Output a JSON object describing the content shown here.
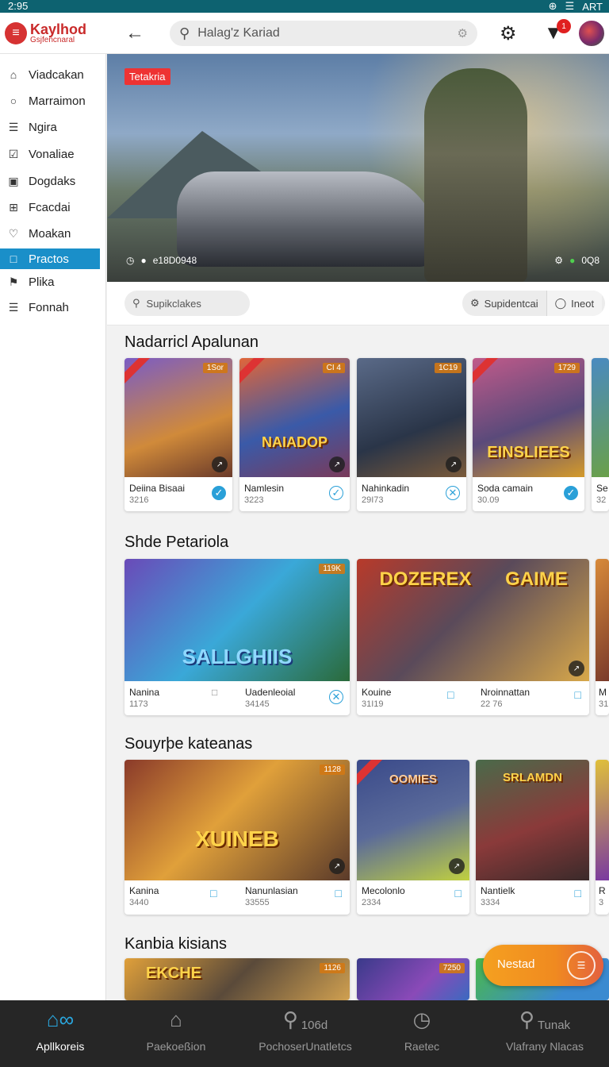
{
  "status_bar": {
    "time": "2:95",
    "right_text": "ART"
  },
  "header": {
    "logo_name": "Kaylhod",
    "logo_sub": "Gsjfencnaral",
    "search_placeholder": "Halag'z Kariad",
    "notification_count": "1"
  },
  "sidebar": {
    "items": [
      {
        "label": "Viadcakan",
        "icon": "house-icon"
      },
      {
        "label": "Marraimon",
        "icon": "user-icon"
      },
      {
        "label": "Ngira",
        "icon": "list-icon"
      },
      {
        "label": "Vonaliae",
        "icon": "checkbox-icon"
      },
      {
        "label": "Dogdaks",
        "icon": "square-icon"
      },
      {
        "label": "Fcacdai",
        "icon": "grid-icon"
      },
      {
        "label": "Moakan",
        "icon": "heart-icon"
      },
      {
        "label": "Practos",
        "icon": "box-icon",
        "active": true
      },
      {
        "label": "Plika",
        "icon": "flag-icon"
      },
      {
        "label": "Fonnah",
        "icon": "list-icon"
      }
    ]
  },
  "hero": {
    "tag": "Tetakria",
    "left_meta": "e18D0948",
    "right_meta": "0Q8"
  },
  "filters": {
    "search_placeholder": "Supikclakes",
    "segment_1": "Supidentcai",
    "segment_2": "Ineot"
  },
  "sections": [
    {
      "title": "Nadarricl Apalunan",
      "cards": [
        {
          "name": "Deiina Bisaai",
          "num": "3216",
          "badge": "1Sor",
          "art_title": ""
        },
        {
          "name": "Namlesin",
          "num": "3223",
          "badge": "CI 4",
          "art_title": "NAIADOP"
        },
        {
          "name": "Nahinkadin",
          "num": "29I73",
          "badge": "1C19",
          "art_title": ""
        },
        {
          "name": "Soda camain",
          "num": "30.09",
          "badge": "1729",
          "art_title": "EINSLIEES"
        },
        {
          "name": "Se",
          "num": "32",
          "badge": "",
          "art_title": ""
        }
      ]
    },
    {
      "title": "Shde Petariola",
      "cards": [
        {
          "name": "Nanina",
          "num": "1173",
          "badge": "",
          "art_title": ""
        },
        {
          "name": "Uadenleoial",
          "num": "34145",
          "badge": "119K",
          "art_title": "SALLGHIIS"
        },
        {
          "name": "Kouine",
          "num": "31I19",
          "badge": "",
          "art_title": "DOZEREX"
        },
        {
          "name": "Nroinnattan",
          "num": "22 76",
          "badge": "",
          "art_title": "GAIME"
        },
        {
          "name": "M",
          "num": "31",
          "badge": "",
          "art_title": ""
        }
      ]
    },
    {
      "title": "Souyrþe kateanas",
      "cards": [
        {
          "name": "Kanina",
          "num": "3440",
          "badge": "",
          "art_title": ""
        },
        {
          "name": "Nanunlasian",
          "num": "33555",
          "badge": "1128",
          "art_title": "XUINEB"
        },
        {
          "name": "Mecolonlo",
          "num": "2334",
          "badge": "",
          "art_title": "OOMIES"
        },
        {
          "name": "Nantielk",
          "num": "3334",
          "badge": "",
          "art_title": "SRLAMDN"
        },
        {
          "name": "R",
          "num": "3",
          "badge": "",
          "art_title": ""
        }
      ]
    },
    {
      "title": "Kanbia kisians",
      "cards": [
        {
          "name": "",
          "num": "",
          "badge": "1126",
          "art_title": "EKCHE"
        },
        {
          "name": "",
          "num": "",
          "badge": "7250",
          "art_title": ""
        },
        {
          "name": "",
          "num": "",
          "badge": "",
          "art_title": ""
        }
      ]
    }
  ],
  "fab": {
    "label": "Nestad"
  },
  "bottom_nav": [
    {
      "label": "Apllkoreis",
      "icon_text": "",
      "active": true
    },
    {
      "label": "Paekoeßion",
      "icon_text": ""
    },
    {
      "label": "PochoserUnatletcs",
      "icon_text": "106d"
    },
    {
      "label": "Raetec",
      "icon_text": ""
    },
    {
      "label": "Vlafrany Nlacas",
      "icon_text": "Tunak"
    }
  ]
}
